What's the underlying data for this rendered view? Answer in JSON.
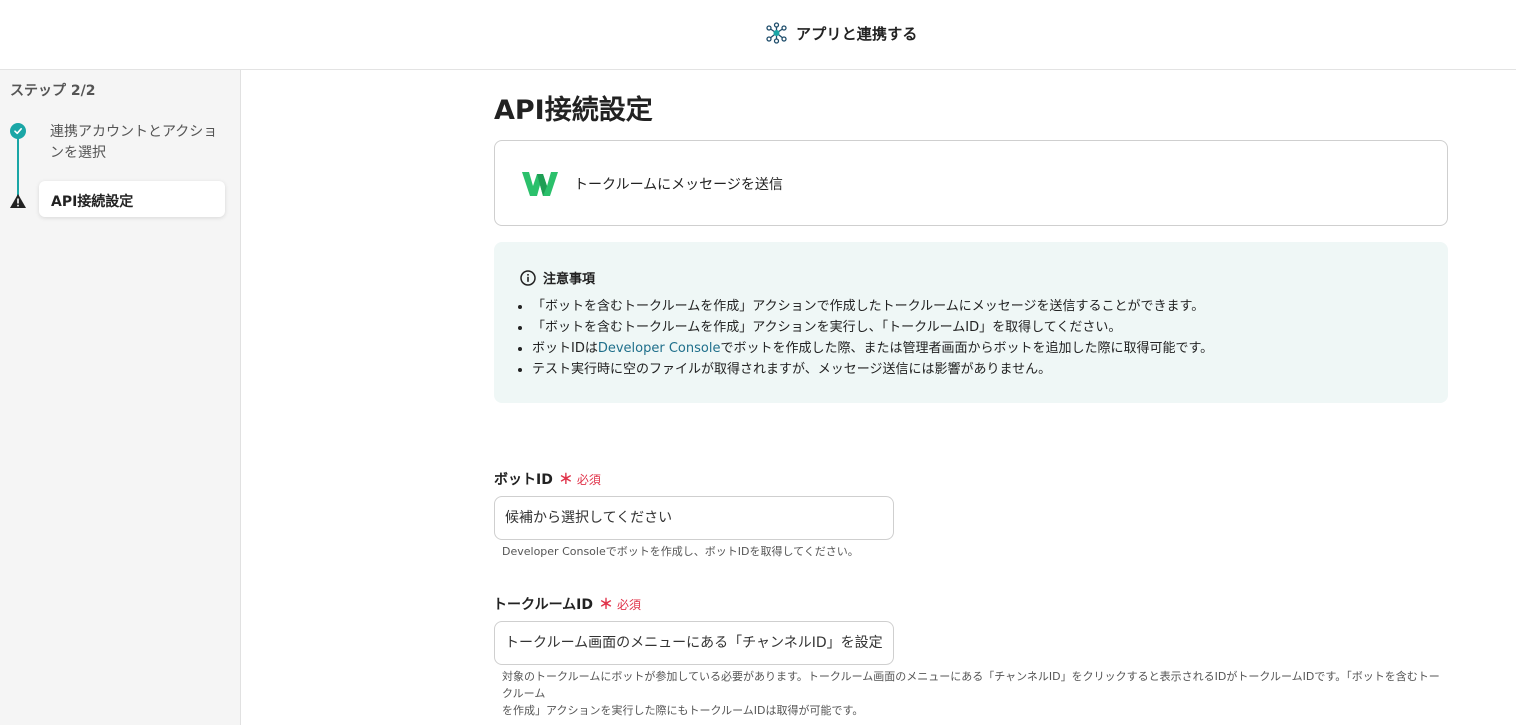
{
  "header": {
    "title": "アプリと連携する"
  },
  "sidebar": {
    "step_label": "ステップ 2/2",
    "steps": [
      {
        "label": "連携アカウントとアクションを選択",
        "status": "done"
      },
      {
        "label": "API接続設定",
        "status": "current-warning"
      }
    ]
  },
  "main": {
    "page_title": "API接続設定",
    "app_card": {
      "action_label": "トークルームにメッセージを送信"
    },
    "notice": {
      "title": "注意事項",
      "items": [
        "「ボットを含むトークルームを作成」アクションで作成したトークルームにメッセージを送信することができます。",
        "「ボットを含むトークルームを作成」アクションを実行し、「トークルームID」を取得してください。",
        {
          "pre": "ボットIDは",
          "link": "Developer Console",
          "post": "でボットを作成した際、または管理者画面からボットを追加した際に取得可能です。"
        },
        "テスト実行時に空のファイルが取得されますが、メッセージ送信には影響がありません。"
      ]
    },
    "fields": {
      "bot_id": {
        "label": "ボットID",
        "required_mark": "＊",
        "required_text": "必須",
        "placeholder": "候補から選択してください",
        "help": "Developer Consoleでボットを作成し、ボットIDを取得してください。"
      },
      "room_id": {
        "label": "トークルームID",
        "required_mark": "＊",
        "required_text": "必須",
        "placeholder": "トークルーム画面のメニューにある「チャンネルID」を設定してください",
        "help_line1": "対象のトークルームにボットが参加している必要があります。トークルーム画面のメニューにある「チャンネルID」をクリックすると表示されるIDがトークルームIDです。「ボットを含むトークルーム",
        "help_line2": "を作成」アクションを実行した際にもトークルームIDは取得が可能です。"
      }
    }
  },
  "colors": {
    "accent": "#1aa6a6",
    "required": "#e0334a",
    "notice_bg": "#eff7f6",
    "link": "#1f6f8b"
  }
}
